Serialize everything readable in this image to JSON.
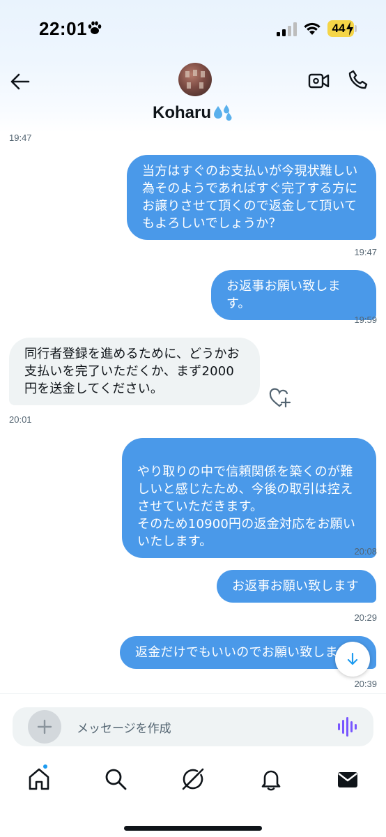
{
  "status_bar": {
    "time": "22:01",
    "battery": "44"
  },
  "header": {
    "contact_name": "Koharu"
  },
  "messages": [
    {
      "direction": "in",
      "text": "",
      "time": "19:47"
    },
    {
      "direction": "out",
      "text": "当方はすぐのお支払いが今現状難しい為そのようであればすぐ完了する方にお譲りさせて頂くので返金して頂いてもよろしいでしょうか？",
      "time": "19:47"
    },
    {
      "direction": "out",
      "text": "お返事お願い致します。",
      "time": "19:59"
    },
    {
      "direction": "in",
      "text": "同行者登録を進めるために、どうかお支払いを完了いただくか、まず2000円を送金してください。",
      "time": "20:01"
    },
    {
      "direction": "out",
      "text": "やり取りの中で信頼関係を築くのが難しいと感じたため、今後の取引は控えさせていただきます。\nそのため10900円の返金対応をお願いいたします。",
      "time": "20:08"
    },
    {
      "direction": "out",
      "text": "お返事お願い致します",
      "time": "20:29"
    },
    {
      "direction": "out",
      "text": "返金だけでもいいのでお願い致します",
      "time": "20:39"
    }
  ],
  "composer": {
    "placeholder": "メッセージを作成"
  },
  "tabs": [
    {
      "name": "home",
      "icon": "home-icon",
      "has_notification": true
    },
    {
      "name": "search",
      "icon": "search-icon"
    },
    {
      "name": "grok",
      "icon": "grok-icon"
    },
    {
      "name": "notifications",
      "icon": "bell-icon"
    },
    {
      "name": "messages",
      "icon": "envelope-icon",
      "active": true
    }
  ],
  "colors": {
    "accent": "#1d9bf0",
    "outgoing_bubble": "#4a99e9",
    "incoming_bubble": "#eff3f4"
  }
}
